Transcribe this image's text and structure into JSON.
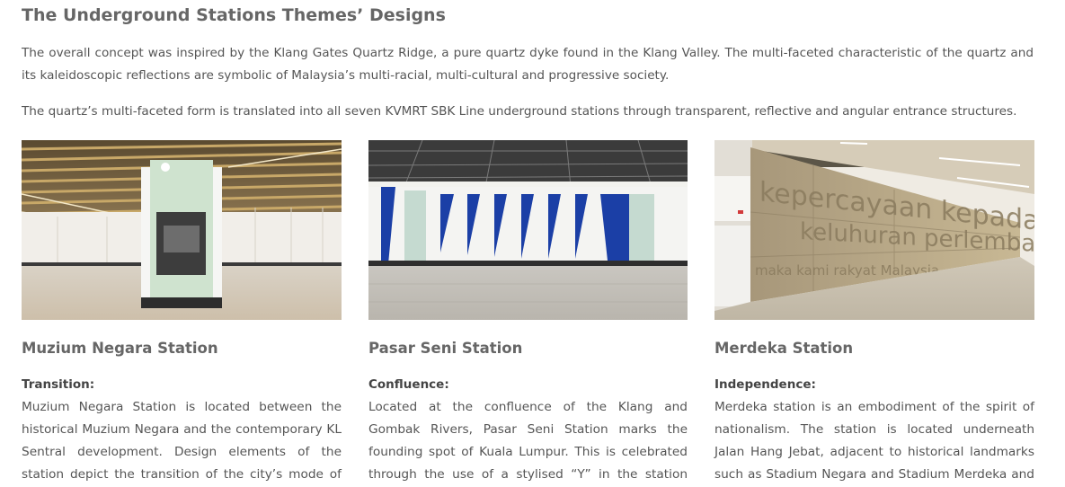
{
  "section": {
    "title": "The Underground Stations Themes’ Designs",
    "intro_1": "The overall concept was inspired by the Klang Gates Quartz Ridge, a pure quartz dyke found in the Klang Valley. The multi-faceted characteristic of the quartz and its kaleidoscopic reflections are symbolic of Malaysia’s multi-racial, multi-cultural and progressive society.",
    "intro_2": "The quartz’s multi-faceted form is translated into all seven KVMRT SBK Line underground stations through transparent, reflective and angular entrance structures."
  },
  "stations": [
    {
      "name": "Muzium Negara Station",
      "theme": "Transition:",
      "description": "Muzium Negara Station is located between the historical Muzium Negara and the contemporary KL Sentral development. Design elements of the station depict the transition of the city’s mode of public"
    },
    {
      "name": "Pasar Seni Station",
      "theme": "Confluence:",
      "description": "Located at the confluence of the Klang and Gombak Rivers, Pasar Seni Station marks the founding spot of Kuala Lumpur. This is celebrated through the use of a stylised “Y” in the station interior, symbolising the"
    },
    {
      "name": "Merdeka Station",
      "theme": "Independence:",
      "description": "Merdeka station is an embodiment of the spirit of nationalism. The station is located underneath Jalan Hang Jebat, adjacent to historical landmarks such as Stadium Negara and Stadium Merdeka and the future"
    }
  ],
  "photo_wall_text": {
    "line_1": "kepercayaan kepada tuhan",
    "line_2": "keluhuran perlembagaan",
    "line_3": "maka kami rakyat Malaysia"
  },
  "colors": {
    "title": "#666666",
    "text": "#555555",
    "pasar_seni_blue": "#1b3fa6"
  }
}
